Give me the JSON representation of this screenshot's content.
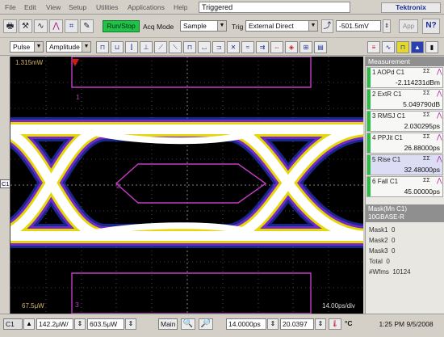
{
  "menu": {
    "items": [
      "File",
      "Edit",
      "View",
      "Setup",
      "Utilities",
      "Applications",
      "Help"
    ],
    "status_title": "Triggered",
    "brand": "Tektronix"
  },
  "toolbar": {
    "run_stop": "Run/Stop",
    "acq_mode_label": "Acq Mode",
    "acq_mode_value": "Sample",
    "trig_label": "Trig",
    "trig_source": "External Direct",
    "trig_level": "-501.5mV",
    "app_label": "App",
    "help_label": "N?"
  },
  "toolbar2": {
    "meas_type": "Pulse",
    "meas_param": "Amplitude"
  },
  "display": {
    "top_label": "1.315mW",
    "bottom_label": "67.5μW",
    "time_scale": "14.00ps/div",
    "mask_segments": [
      "1",
      "2",
      "3"
    ],
    "channel_marker": "C1"
  },
  "measurement": {
    "header": "Measurement",
    "items": [
      {
        "index": "1",
        "name": "AOPd",
        "source": "C1",
        "stat": "ΣΣ",
        "value": "-2.114231dBm"
      },
      {
        "index": "2",
        "name": "ExtR",
        "source": "C1",
        "stat": "ΣΣ",
        "value": "5.049790dB"
      },
      {
        "index": "3",
        "name": "RMSJ",
        "source": "C1",
        "stat": "ΣΣ",
        "value": "2.030295ps"
      },
      {
        "index": "4",
        "name": "PPJit",
        "source": "C1",
        "stat": "ΣΣ",
        "value": "26.88000ps"
      },
      {
        "index": "5",
        "name": "Rise",
        "source": "C1",
        "stat": "ΣΣ",
        "value": "32.48000ps"
      },
      {
        "index": "6",
        "name": "Fall",
        "source": "C1",
        "stat": "ΣΣ",
        "value": "45.00000ps"
      }
    ],
    "mask_header_line1": "Mask(Mn C1)",
    "mask_header_line2": "10GBASE-R",
    "mask_stats": [
      {
        "label": "Mask1",
        "value": "0"
      },
      {
        "label": "Mask2",
        "value": "0"
      },
      {
        "label": "Mask3",
        "value": "0"
      },
      {
        "label": "Total",
        "value": "0"
      },
      {
        "label": "#Wfms",
        "value": "10124"
      }
    ]
  },
  "bottom": {
    "channel": "C1",
    "vert_scale": "142.2μW/",
    "vert_offset": "603.5μW",
    "timebase": "Main",
    "horiz_scale": "14.0000ps",
    "horiz_pos": "20.0397",
    "temperature_unit": "°C",
    "clock": "1:25 PM 9/5/2008"
  },
  "colors": {
    "run_stop": "#22c24a",
    "mask_lines": "#c23cc6",
    "eye_core": "#ffffff",
    "eye_edge": "#e5d70a",
    "eye_noise": "#2b48ff"
  }
}
